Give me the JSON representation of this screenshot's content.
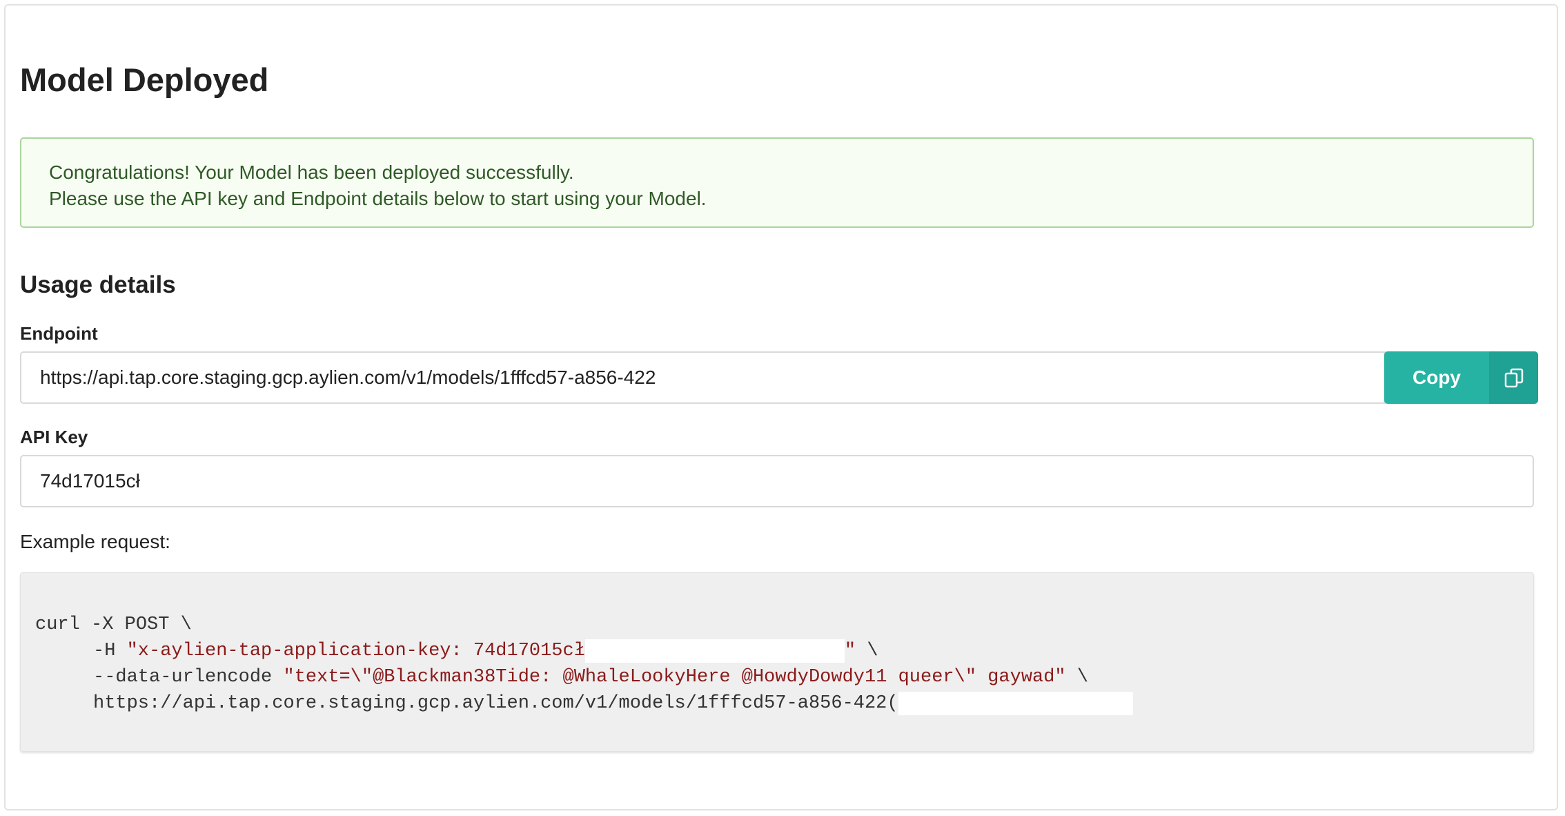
{
  "page": {
    "title": "Model Deployed"
  },
  "alert": {
    "line1": "Congratulations! Your Model has been deployed successfully.",
    "line2": "Please use the API key and Endpoint details below to start using your Model."
  },
  "usage": {
    "title": "Usage details",
    "endpoint_label": "Endpoint",
    "endpoint_value": "https://api.tap.core.staging.gcp.aylien.com/v1/models/1fffcd57-a856-422",
    "copy_label": "Copy",
    "api_key_label": "API Key",
    "api_key_value": "74d17015cł",
    "example_label": "Example request:"
  },
  "code": {
    "line1": "curl -X POST \\",
    "line2_flag": "-H ",
    "line2_str": "\"x-aylien-tap-application-key: 74d17015cł",
    "line2_end_str": "\"",
    "line2_tail": " \\",
    "line3_flag": "--data-urlencode ",
    "line3_str": "\"text=\\\"@Blackman38Tide: @WhaleLookyHere @HowdyDowdy11 queer\\\" gaywad\"",
    "line3_tail": " \\",
    "line4": "https://api.tap.core.staging.gcp.aylien.com/v1/models/1fffcd57-a856-422("
  },
  "icons": {
    "copy": "copy-icon"
  },
  "colors": {
    "accent": "#26b3a3",
    "accent_dark": "#1fa193",
    "alert_text": "#2f5a26",
    "alert_border": "#a9d59d",
    "code_string": "#8b1a1a"
  }
}
